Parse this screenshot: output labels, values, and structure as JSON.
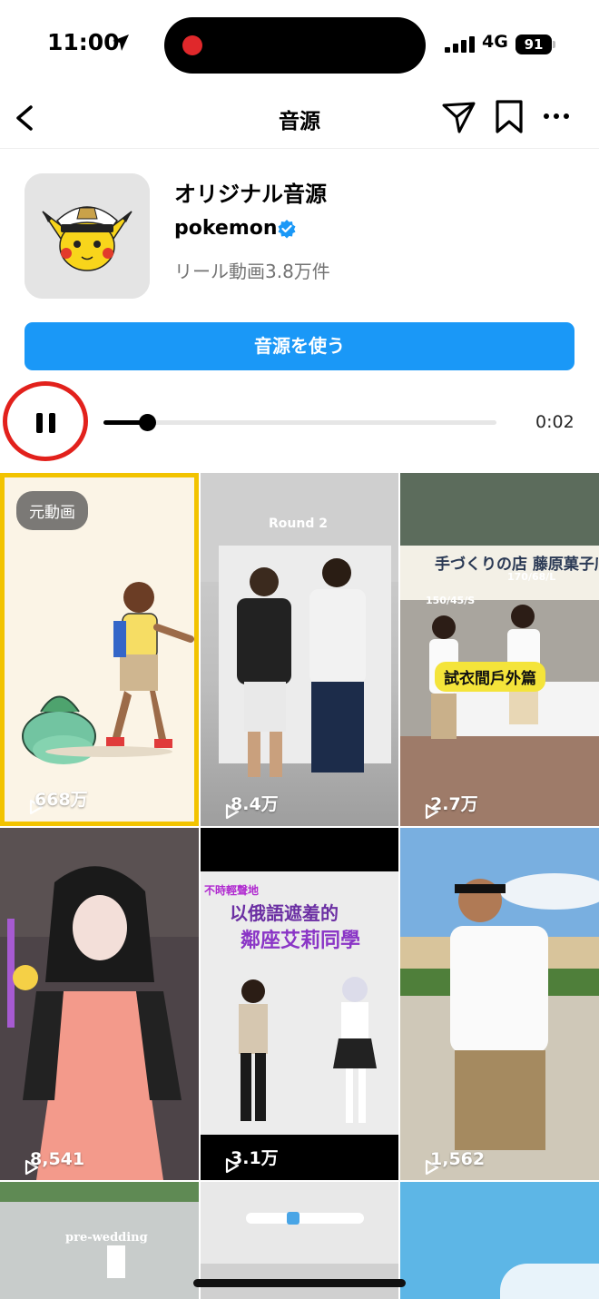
{
  "status": {
    "time": "11:00",
    "network": "4G",
    "battery": "91"
  },
  "nav": {
    "title": "音源"
  },
  "audio": {
    "title": "オリジナル音源",
    "artist": "pokemon",
    "reel_count": "リール動画3.8万件",
    "use_button": "音源を使う"
  },
  "player": {
    "elapsed": "0:02",
    "progress": 0.11
  },
  "grid": {
    "original_badge": "元動画",
    "tiles": [
      {
        "views": "668万",
        "text": ""
      },
      {
        "views": "8.4万",
        "text": "Round 2"
      },
      {
        "views": "2.7万",
        "text": "試衣間戶外篇",
        "sign": "手づくりの店 藤原菓子店",
        "label_s": "150/45/S",
        "label_l": "170/68/L"
      },
      {
        "views": "8,541",
        "text": ""
      },
      {
        "views": "3.1万",
        "text": "以俄語遮羞的",
        "line2": "鄰座艾莉同學",
        "small": "不時輕聲地"
      },
      {
        "views": "1,562",
        "text": ""
      },
      {
        "views": "",
        "text": "pre-wedding"
      },
      {
        "views": "",
        "text": ""
      },
      {
        "views": "",
        "text": ""
      }
    ]
  },
  "colors": {
    "accent": "#1a98f7",
    "highlight_ring": "#e2211c",
    "original_border": "#f2c300"
  }
}
